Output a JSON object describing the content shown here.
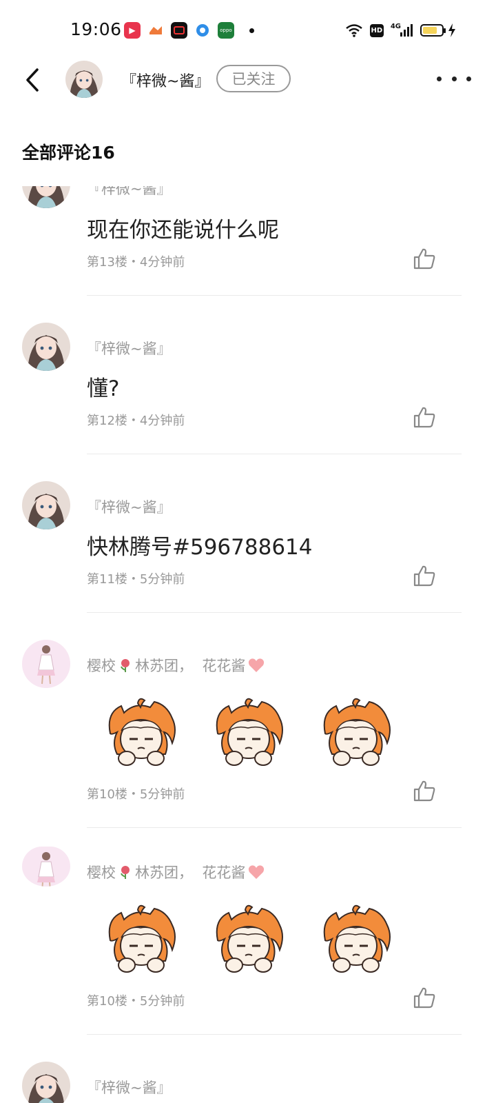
{
  "status_bar": {
    "time": "19:06",
    "app_icons": [
      "video-app-icon",
      "game-app-icon",
      "record-app-icon",
      "browser-app-icon",
      "oppo-app-icon"
    ],
    "hd_label": "HD",
    "network_label": "4G",
    "battery_level": 0.78
  },
  "header": {
    "name": "『梓微~酱』",
    "follow_label": "已关注"
  },
  "comments_title": "全部评论16",
  "comments": [
    {
      "name": "『梓微~酱』",
      "text": "现在你还能说什么呢",
      "meta": "第13楼・4分钟前"
    },
    {
      "name": "『梓微~酱』",
      "text": "懂?",
      "meta": "第12楼・4分钟前"
    },
    {
      "name": "『梓微~酱』",
      "text": "快林腾号#596788614",
      "meta": "第11楼・5分钟前"
    },
    {
      "name_prefix": "樱校",
      "name_middle": "林苏团，",
      "name_suffix": "花花酱",
      "meta": "第10楼・5分钟前"
    },
    {
      "name_prefix": "樱校",
      "name_middle": "林苏团，",
      "name_suffix": "花花酱",
      "meta": "第10楼・5分钟前"
    },
    {
      "name": "『梓微~酱』"
    }
  ],
  "colors": {
    "secondary_text": "#999999",
    "sticker_orange": "#f28c3b",
    "divider": "#eaeaea"
  }
}
